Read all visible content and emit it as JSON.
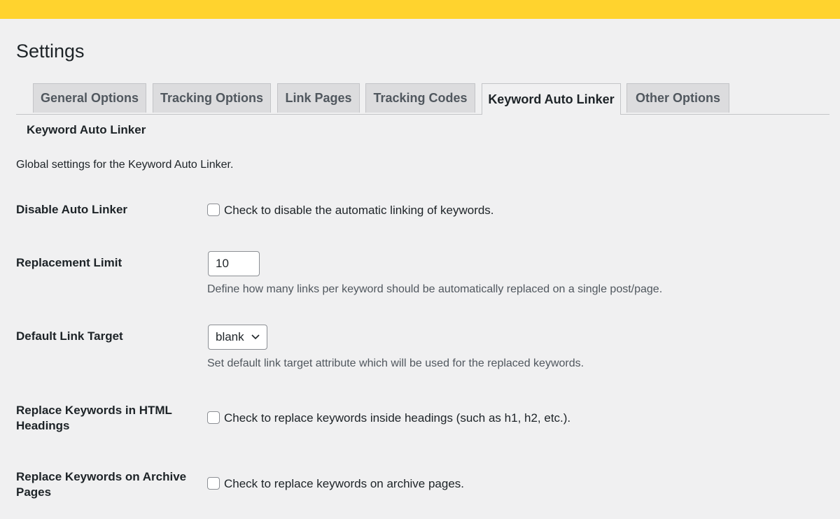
{
  "page": {
    "title": "Settings"
  },
  "tabs": [
    {
      "label": "General Options"
    },
    {
      "label": "Tracking Options"
    },
    {
      "label": "Link Pages"
    },
    {
      "label": "Tracking Codes"
    },
    {
      "label": "Keyword Auto Linker",
      "active": true
    },
    {
      "label": "Other Options"
    }
  ],
  "section": {
    "title": "Keyword Auto Linker",
    "description": "Global settings for the Keyword Auto Linker."
  },
  "settings": {
    "disable_auto_linker": {
      "label": "Disable Auto Linker",
      "checkbox_text": "Check to disable the automatic linking of keywords.",
      "checked": false
    },
    "replacement_limit": {
      "label": "Replacement Limit",
      "value": "10",
      "description": "Define how many links per keyword should be automatically replaced on a single post/page."
    },
    "default_link_target": {
      "label": "Default Link Target",
      "selected": "blank",
      "description": "Set default link target attribute which will be used for the replaced keywords."
    },
    "replace_in_headings": {
      "label_line1": "Replace Keywords in HTML",
      "label_line2": "Headings",
      "checkbox_text": "Check to replace keywords inside headings (such as h1, h2, etc.).",
      "checked": false
    },
    "replace_on_archives": {
      "label_line1": "Replace Keywords on Archive",
      "label_line2": "Pages",
      "checkbox_text": "Check to replace keywords on archive pages.",
      "checked": false
    }
  },
  "colors": {
    "topbar": "#ffd32e",
    "background": "#f0f0f1",
    "tab_inactive": "#dcdcde"
  }
}
